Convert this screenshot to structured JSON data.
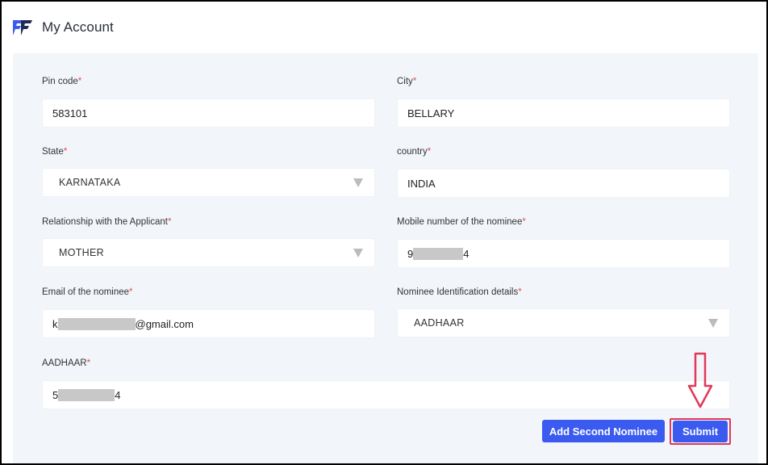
{
  "header": {
    "title": "My Account"
  },
  "form": {
    "pin_code": {
      "label": "Pin code",
      "value": "583101"
    },
    "city": {
      "label": "City",
      "value": "BELLARY"
    },
    "state": {
      "label": "State",
      "value": "KARNATAKA"
    },
    "country": {
      "label": "country",
      "value": "INDIA"
    },
    "relationship": {
      "label": "Relationship with the Applicant",
      "value": "MOTHER"
    },
    "mobile": {
      "label": "Mobile number of the nominee",
      "prefix": "9",
      "suffix": "4"
    },
    "email": {
      "label": "Email of the nominee",
      "prefix": "k",
      "suffix": "@gmail.com"
    },
    "id_details": {
      "label": "Nominee Identification details",
      "value": "AADHAAR"
    },
    "aadhaar": {
      "label": "AADHAAR",
      "prefix": "5",
      "suffix": "4"
    },
    "required_marker": "*"
  },
  "buttons": {
    "add_second_nominee": "Add Second Nominee",
    "submit": "Submit"
  },
  "colors": {
    "primary": "#3b5bf0",
    "highlight": "#e0385a",
    "panel_bg": "#f2f6fb",
    "required": "#d9534f"
  }
}
